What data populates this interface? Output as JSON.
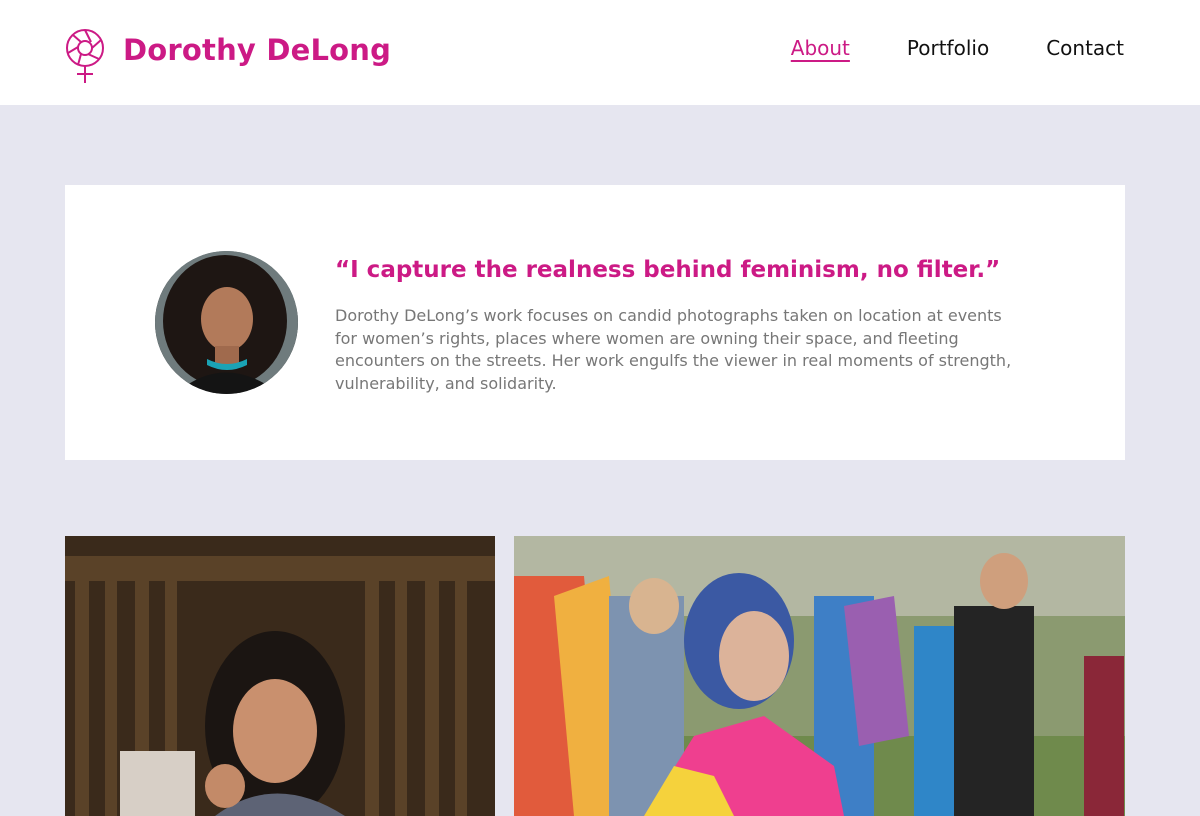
{
  "header": {
    "brand_name": "Dorothy DeLong",
    "logo_icon": "female-symbol-aperture-icon",
    "nav": [
      {
        "label": "About",
        "active": true
      },
      {
        "label": "Portfolio",
        "active": false
      },
      {
        "label": "Contact",
        "active": false
      }
    ]
  },
  "about": {
    "quote": "“I capture the realness behind feminism, no filter.”",
    "bio": "Dorothy DeLong’s work focuses on candid photographs taken on location at events for women’s rights, places where women are owning their space, and fleeting encounters on the streets. Her work engulfs the viewer in real moments of strength, vulnerability, and solidarity."
  },
  "colors": {
    "brand": "#cc1a85",
    "page_background": "#e6e6f0",
    "card_background": "#ffffff"
  }
}
